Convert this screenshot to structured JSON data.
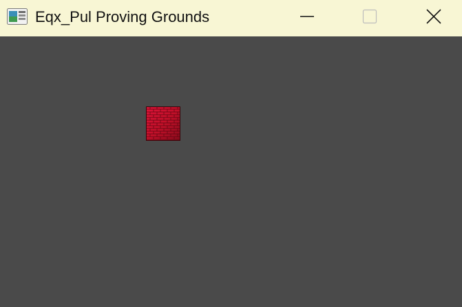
{
  "window": {
    "title": "Eqx_Pul Proving Grounds",
    "icon": "app-window-icon",
    "controls": {
      "minimize_icon": "minimize-icon",
      "maximize_icon": "maximize-icon",
      "close_icon": "close-icon"
    },
    "titlebar_color": "#f8f6d4"
  },
  "game": {
    "background_color": "#4a4a4a",
    "sprites": [
      {
        "type": "red-brick-block",
        "color": "#c4102a"
      }
    ]
  }
}
